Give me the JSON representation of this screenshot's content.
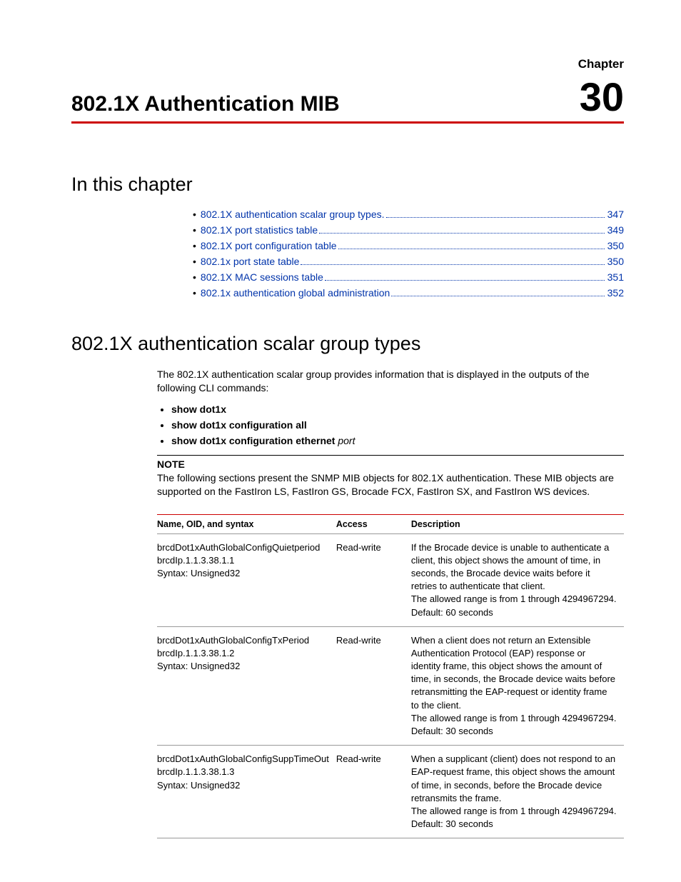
{
  "header": {
    "chapter_label": "Chapter",
    "chapter_title": "802.1X Authentication MIB",
    "chapter_number": "30"
  },
  "sections": {
    "in_this_chapter": "In this chapter",
    "scalar_group": "802.1X authentication scalar group types"
  },
  "toc": [
    {
      "label": "802.1X authentication scalar group types",
      "page": "347"
    },
    {
      "label": "802.1X port statistics table",
      "page": "349"
    },
    {
      "label": "802.1X port configuration table",
      "page": "350"
    },
    {
      "label": "802.1x port state table",
      "page": "350"
    },
    {
      "label": "802.1X MAC sessions table",
      "page": "351"
    },
    {
      "label": "802.1x authentication global administration",
      "page": "352"
    }
  ],
  "intro_text": "The 802.1X authentication scalar group provides information that is displayed in the outputs of the following CLI commands:",
  "commands": [
    {
      "text": "show dot1x",
      "ital": ""
    },
    {
      "text": "show dot1x configuration all",
      "ital": ""
    },
    {
      "text": "show dot1x configuration ethernet ",
      "ital": "port"
    }
  ],
  "note": {
    "heading": "NOTE",
    "body": "The following sections present the SNMP MIB objects for 802.1X authentication. These MIB objects are supported on the FastIron LS, FastIron GS, Brocade FCX, FastIron SX, and FastIron WS devices."
  },
  "table": {
    "headers": {
      "name": "Name, OID, and syntax",
      "access": "Access",
      "description": "Description"
    },
    "rows": [
      {
        "name_lines": [
          "brcdDot1xAuthGlobalConfigQuietperiod",
          "brcdIp.1.1.3.38.1.1",
          "Syntax: Unsigned32"
        ],
        "access": "Read-write",
        "desc_lines": [
          "If the Brocade device is unable to authenticate a client, this object shows the amount of time, in seconds, the Brocade device waits before it retries to authenticate that client.",
          "The allowed range is from 1 through 4294967294.",
          "Default: 60 seconds"
        ]
      },
      {
        "name_lines": [
          "brcdDot1xAuthGlobalConfigTxPeriod",
          "brcdIp.1.1.3.38.1.2",
          "Syntax: Unsigned32"
        ],
        "access": "Read-write",
        "desc_lines": [
          "When a client does not return an Extensible Authentication Protocol (EAP) response or identity frame, this object shows the amount of time, in seconds, the Brocade device waits before retransmitting the EAP-request or identity frame to the client.",
          "The allowed range is from 1 through 4294967294.",
          "Default: 30 seconds"
        ]
      },
      {
        "name_lines": [
          "brcdDot1xAuthGlobalConfigSuppTimeOut",
          "brcdIp.1.1.3.38.1.3",
          "Syntax: Unsigned32"
        ],
        "access": "Read-write",
        "desc_lines": [
          "When a supplicant (client) does not respond to an EAP-request frame, this object shows the amount of time, in seconds, before the Brocade device retransmits the frame.",
          "The allowed range is from 1 through 4294967294.",
          "Default: 30 seconds"
        ]
      }
    ]
  }
}
